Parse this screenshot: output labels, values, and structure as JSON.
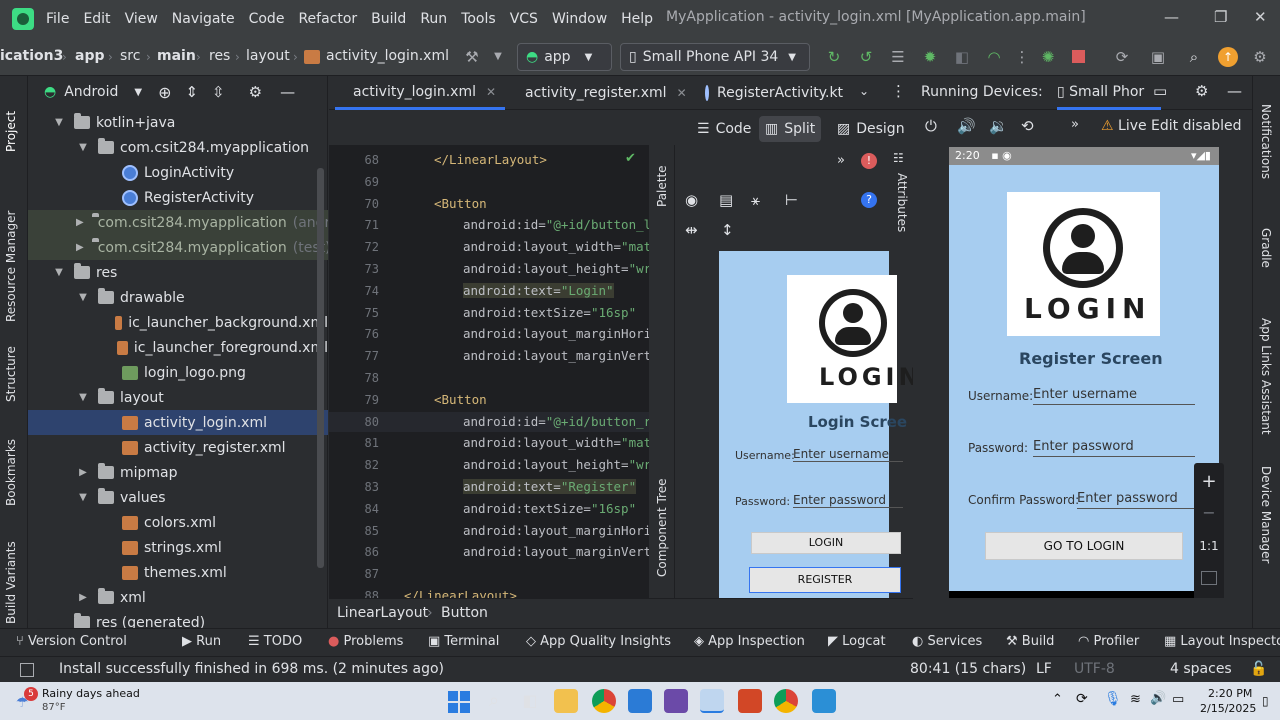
{
  "menu": [
    "File",
    "Edit",
    "View",
    "Navigate",
    "Code",
    "Refactor",
    "Build",
    "Run",
    "Tools",
    "VCS",
    "Window",
    "Help"
  ],
  "window_title": "MyApplication - activity_login.xml [MyApplication.app.main]",
  "navbar": {
    "crumbs": [
      "ication3",
      "app",
      "src",
      "main",
      "res",
      "layout",
      "activity_login.xml"
    ],
    "run_config": "app",
    "device": "Small Phone API 34"
  },
  "project": {
    "view_label": "Android",
    "tree": [
      {
        "label": "kotlin+java",
        "type": "folder",
        "level": 1,
        "arrow": "open"
      },
      {
        "label": "com.csit284.myapplication",
        "type": "folder",
        "level": 2,
        "arrow": "open"
      },
      {
        "label": "LoginActivity",
        "type": "kt",
        "level": 3,
        "arrow": ""
      },
      {
        "label": "RegisterActivity",
        "type": "kt",
        "level": 3,
        "arrow": ""
      },
      {
        "label": "com.csit284.myapplication",
        "suffix": "(andr",
        "type": "folder",
        "level": 2,
        "arrow": "closed",
        "dim": true
      },
      {
        "label": "com.csit284.myapplication",
        "suffix": "(test)",
        "type": "folder",
        "level": 2,
        "arrow": "closed",
        "dim": true
      },
      {
        "label": "res",
        "type": "folder",
        "level": 1,
        "arrow": "open"
      },
      {
        "label": "drawable",
        "type": "folder",
        "level": 2,
        "arrow": "open"
      },
      {
        "label": "ic_launcher_background.xml",
        "type": "xml",
        "level": 3,
        "arrow": ""
      },
      {
        "label": "ic_launcher_foreground.xml",
        "type": "xml",
        "level": 3,
        "arrow": ""
      },
      {
        "label": "login_logo.png",
        "type": "png",
        "level": 3,
        "arrow": ""
      },
      {
        "label": "layout",
        "type": "folder",
        "level": 2,
        "arrow": "open"
      },
      {
        "label": "activity_login.xml",
        "type": "xml",
        "level": 3,
        "arrow": "",
        "selected": true
      },
      {
        "label": "activity_register.xml",
        "type": "xml",
        "level": 3,
        "arrow": ""
      },
      {
        "label": "mipmap",
        "type": "folder",
        "level": 2,
        "arrow": "closed"
      },
      {
        "label": "values",
        "type": "folder",
        "level": 2,
        "arrow": "open"
      },
      {
        "label": "colors.xml",
        "type": "xml",
        "level": 3,
        "arrow": ""
      },
      {
        "label": "strings.xml",
        "type": "xml",
        "level": 3,
        "arrow": ""
      },
      {
        "label": "themes.xml",
        "type": "xml",
        "level": 3,
        "arrow": ""
      },
      {
        "label": "xml",
        "type": "folder",
        "level": 2,
        "arrow": "closed"
      },
      {
        "label": "res (generated)",
        "type": "folder",
        "level": 1,
        "arrow": ""
      }
    ]
  },
  "left_stripe": [
    "Project",
    "Resource Manager",
    "Structure",
    "Bookmarks",
    "Build Variants"
  ],
  "right_stripe": [
    "Notifications",
    "Gradle",
    "App Links Assistant",
    "Device Manager"
  ],
  "tabs": [
    {
      "label": "activity_login.xml",
      "active": true
    },
    {
      "label": "activity_register.xml",
      "active": false
    },
    {
      "label": "RegisterActivity.kt",
      "active": false
    }
  ],
  "modes": [
    "Code",
    "Split",
    "Design"
  ],
  "code_lines": [
    {
      "n": "68",
      "text": "</LinearLayout>",
      "kind": "tag"
    },
    {
      "n": "69",
      "text": "",
      "kind": "plain"
    },
    {
      "n": "70",
      "text": "<Button",
      "kind": "tag"
    },
    {
      "n": "71",
      "attr": "android:id=",
      "val": "\"@+id/button_l",
      "kind": "av"
    },
    {
      "n": "72",
      "attr": "android:layout_width=",
      "val": "\"matc",
      "kind": "av"
    },
    {
      "n": "73",
      "attr": "android:layout_height=",
      "val": "\"wra",
      "kind": "av"
    },
    {
      "n": "74",
      "attr": "android:text=",
      "val": "\"Login\"",
      "kind": "av",
      "hl": true
    },
    {
      "n": "75",
      "attr": "android:textSize=",
      "val": "\"16sp\"",
      "kind": "av"
    },
    {
      "n": "76",
      "attr": "android:layout_marginHori",
      "val": "",
      "kind": "av"
    },
    {
      "n": "77",
      "attr": "android:layout_marginVert",
      "val": "",
      "kind": "av"
    },
    {
      "n": "78",
      "text": "",
      "kind": "plain"
    },
    {
      "n": "79",
      "text": "<Button",
      "kind": "tag"
    },
    {
      "n": "80",
      "attr": "android:id=",
      "val": "\"@+id/button_re",
      "kind": "av",
      "cur": true
    },
    {
      "n": "81",
      "attr": "android:layout_width=",
      "val": "\"matc",
      "kind": "av"
    },
    {
      "n": "82",
      "attr": "android:layout_height=",
      "val": "\"wra",
      "kind": "av"
    },
    {
      "n": "83",
      "attr": "android:text=",
      "val": "\"Register\"",
      "kind": "av",
      "hl": true
    },
    {
      "n": "84",
      "attr": "android:textSize=",
      "val": "\"16sp\"",
      "kind": "av"
    },
    {
      "n": "85",
      "attr": "android:layout_marginHori",
      "val": "",
      "kind": "av"
    },
    {
      "n": "86",
      "attr": "android:layout_marginVert",
      "val": "",
      "kind": "av"
    },
    {
      "n": "87",
      "text": "",
      "kind": "plain"
    },
    {
      "n": "88",
      "text": "</LinearLayout>",
      "kind": "tag"
    }
  ],
  "design": {
    "palette": "Palette",
    "component_tree": "Component Tree",
    "attributes": "Attributes",
    "logo_text": "LOGIN",
    "screen_title": "Login Scree",
    "username_label": "Username:",
    "username_hint": "Enter username",
    "password_label": "Password:",
    "password_hint": "Enter password",
    "login_btn": "LOGIN",
    "register_btn": "REGISTER"
  },
  "running": {
    "title": "Running Devices:",
    "device_tab": "Small Phor",
    "live_edit": "Live Edit disabled",
    "status_time": "2:20",
    "logo_text": "LOGIN",
    "screen_title": "Register Screen",
    "username_label": "Username:",
    "username_hint": "Enter username",
    "password_label": "Password:",
    "password_hint": "Enter password",
    "confirm_label": "Confirm Password:",
    "confirm_hint": "Enter password",
    "go_btn": "GO TO LOGIN",
    "zoom": [
      "+",
      "−",
      "1:1"
    ]
  },
  "breadcrumb": [
    "LinearLayout",
    "Button"
  ],
  "toolwindows": [
    "Version Control",
    "Run",
    "TODO",
    "Problems",
    "Terminal",
    "App Quality Insights",
    "App Inspection",
    "Logcat",
    "Services",
    "Build",
    "Profiler",
    "Layout Inspecto"
  ],
  "status": {
    "message": "Install successfully finished in 698 ms. (2 minutes ago)",
    "position": "80:41 (15 chars)",
    "line_sep": "LF",
    "encoding": "UTF-8",
    "indent": "4 spaces"
  },
  "taskbar": {
    "weather_title": "Rainy days ahead",
    "weather_temp": "87°F",
    "badge": "5",
    "time": "2:20 PM",
    "date": "2/15/2025"
  }
}
